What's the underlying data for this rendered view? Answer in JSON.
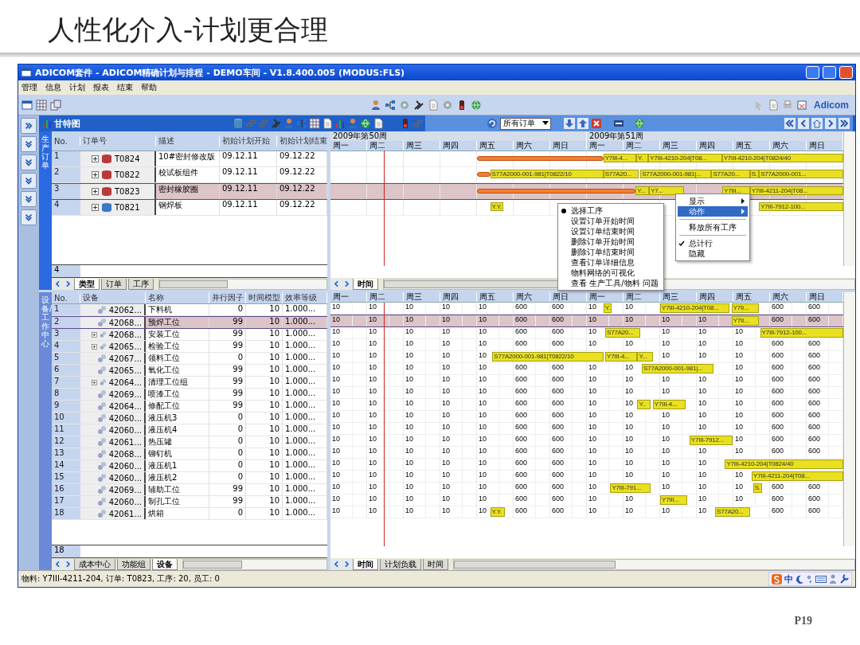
{
  "slide": {
    "title": "人性化介入-计划更合理",
    "page": "P19"
  },
  "window": {
    "title": "ADICOM套件 - ADICOM精确计划与排程 - DEMO车间 - V1.8.400.005 (MODUS:FLS)"
  },
  "menu": [
    "管理",
    "信息",
    "计划",
    "报表",
    "结束",
    "帮助"
  ],
  "toolbar": {
    "logo": "Adicom"
  },
  "gantt_header": {
    "title": "甘特图",
    "filter": "所有订单"
  },
  "orders": {
    "side_label": "生产订单",
    "columns": [
      "No.",
      "订单号",
      "描述",
      "初始计划开始",
      "初始计划结束"
    ],
    "weeks": [
      "2009年第50周",
      "2009年第51周"
    ],
    "days": [
      "周一",
      "周二",
      "周三",
      "周四",
      "周五",
      "周六",
      "周日",
      "周一",
      "周二",
      "周三",
      "周四",
      "周五",
      "周六",
      "周日"
    ],
    "rows": [
      {
        "no": "1",
        "order": "T0824",
        "desc": "10#密封修改版",
        "start": "09.12.11",
        "end": "09.12.22",
        "color": "#b83a3a",
        "has_children": true,
        "selected": false,
        "bars": [
          {
            "kind": "order"
          },
          {
            "kind": "task",
            "text": "Y7III-4..."
          },
          {
            "kind": "task",
            "text": "Y."
          },
          {
            "kind": "task",
            "text": "Y7III-4210-204|T08..."
          },
          {
            "kind": "task",
            "text": "Y7III-4210-204|T0824/40"
          }
        ]
      },
      {
        "no": "2",
        "order": "T0822",
        "desc": "校试板组件",
        "start": "09.12.11",
        "end": "09.12.22",
        "color": "#b83a3a",
        "has_children": true,
        "selected": false,
        "bars": [
          {
            "kind": "order"
          },
          {
            "kind": "task",
            "text": "S77A2000-001-981|T0822/10"
          },
          {
            "kind": "task",
            "text": "S77A20..."
          },
          {
            "kind": "task",
            "text": "S77A2000-001-981|..."
          },
          {
            "kind": "task",
            "text": "S77A20..."
          },
          {
            "kind": "task",
            "text": "S."
          },
          {
            "kind": "task",
            "text": "S77A2000-001..."
          }
        ]
      },
      {
        "no": "3",
        "order": "T0823",
        "desc": "密封橡胶圈",
        "start": "09.12.11",
        "end": "09.12.22",
        "color": "#b83a3a",
        "has_children": true,
        "selected": true,
        "bars": [
          {
            "kind": "order"
          },
          {
            "kind": "task",
            "text": "Y..."
          },
          {
            "kind": "task",
            "text": "Y7..."
          },
          {
            "kind": "task",
            "text": "Y7III..."
          },
          {
            "kind": "task",
            "text": "Y7III-4211-204|T08..."
          }
        ]
      },
      {
        "no": "4",
        "order": "T0821",
        "desc": "钢焊板",
        "start": "09.12.11",
        "end": "09.12.22",
        "color": "#3a78c8",
        "has_children": true,
        "selected": false,
        "bars": [
          {
            "kind": "task",
            "text": "Y.Y."
          },
          {
            "kind": "task",
            "text": "Y7III-7912-100..."
          }
        ]
      }
    ],
    "count": "4",
    "tabs": [
      {
        "label": "类型",
        "selected": true
      },
      {
        "label": "订单",
        "selected": false
      },
      {
        "label": "工序",
        "selected": false
      }
    ],
    "chart_tabs": [
      {
        "label": "时间",
        "selected": true
      }
    ]
  },
  "context_menu": {
    "items": [
      {
        "kind": "item",
        "label": "显示",
        "submenu": true,
        "selected": false
      },
      {
        "kind": "item",
        "label": "动作",
        "submenu": true,
        "selected": true
      },
      {
        "kind": "separator"
      },
      {
        "kind": "item",
        "label": "释放所有工序",
        "submenu": false,
        "selected": false
      },
      {
        "kind": "separator"
      },
      {
        "kind": "check",
        "label": "总计行",
        "checked": true
      },
      {
        "kind": "check",
        "label": "隐藏",
        "checked": false
      }
    ],
    "submenu": [
      {
        "label": "选择工序",
        "checked": true
      },
      {
        "label": "设置订单开始时间",
        "checked": false
      },
      {
        "label": "设置订单结束时间",
        "checked": false
      },
      {
        "label": "删除订单开始时间",
        "checked": false
      },
      {
        "label": "删除订单结束时间",
        "checked": false
      },
      {
        "label": "查看订单详细信息",
        "checked": false
      },
      {
        "label": "物料网络的可视化",
        "checked": false
      },
      {
        "label": "查看 生产工具/物料 问题",
        "checked": false
      }
    ]
  },
  "resources": {
    "side_label": "设备/工作中心",
    "columns": [
      "No.",
      "设备",
      "名称",
      "并行因子",
      "时间模型",
      "效率等级"
    ],
    "days": [
      "周一",
      "周二",
      "周三",
      "周四",
      "周五",
      "周六",
      "周日",
      "周一",
      "周二",
      "周三",
      "周四",
      "周五",
      "周六",
      "周日"
    ],
    "rows": [
      {
        "no": "1",
        "id": "42062...",
        "name": "下料机",
        "parallel": "0",
        "time_model": "10",
        "efficiency": "1.000...",
        "has_children": false,
        "selected": false,
        "cells": [
          "10",
          "10",
          "10",
          "10",
          "10",
          "600",
          "600",
          "10",
          "10",
          null,
          null,
          null,
          "600",
          "600"
        ],
        "bars": [
          {
            "text": "Y."
          },
          {
            "text": "Y7III-4210-204|T08..."
          },
          {
            "text": "Y7II..."
          }
        ]
      },
      {
        "no": "2",
        "id": "42068...",
        "name": "预焊工位",
        "parallel": "99",
        "time_model": "10",
        "efficiency": "1.000...",
        "has_children": false,
        "selected": true,
        "cells": [
          "10",
          "10",
          "10",
          "10",
          "10",
          "600",
          "600",
          "10",
          "10",
          "10",
          "10",
          null,
          "600",
          "600"
        ],
        "bars": [
          {
            "text": "Y7II..."
          }
        ]
      },
      {
        "no": "3",
        "id": "42068...",
        "name": "安装工位",
        "parallel": "99",
        "time_model": "10",
        "efficiency": "1.000...",
        "has_children": true,
        "selected": false,
        "cells": [
          "10",
          "10",
          "10",
          "10",
          "10",
          "600",
          "600",
          "10",
          null,
          "10",
          "10",
          "10",
          null,
          null
        ],
        "bars": [
          {
            "text": "S77A20..."
          },
          {
            "text": "Y7III-7912-100..."
          }
        ]
      },
      {
        "no": "4",
        "id": "42065...",
        "name": "检验工位",
        "parallel": "99",
        "time_model": "10",
        "efficiency": "1.000...",
        "has_children": true,
        "selected": false,
        "cells": [
          "10",
          "10",
          "10",
          "10",
          "10",
          "600",
          "600",
          "10",
          "10",
          "10",
          "10",
          "10",
          "600",
          "600"
        ],
        "bars": []
      },
      {
        "no": "5",
        "id": "42067...",
        "name": "领料工位",
        "parallel": "0",
        "time_model": "10",
        "efficiency": "1.000...",
        "has_children": false,
        "selected": false,
        "cells": [
          "10",
          "10",
          "10",
          "10",
          "10",
          null,
          null,
          null,
          null,
          "10",
          "10",
          "10",
          "600",
          "600"
        ],
        "bars": [
          {
            "text": "S77A2000-001-981|T0822/10"
          },
          {
            "text": "Y7III-4..."
          },
          {
            "text": "Y..."
          }
        ]
      },
      {
        "no": "6",
        "id": "42065...",
        "name": "氧化工位",
        "parallel": "99",
        "time_model": "10",
        "efficiency": "1.000...",
        "has_children": false,
        "selected": false,
        "cells": [
          "10",
          "10",
          "10",
          "10",
          "10",
          "600",
          "600",
          "10",
          "10",
          null,
          null,
          "10",
          "600",
          "600"
        ],
        "bars": [
          {
            "text": "S77A2000-001-981|..."
          }
        ]
      },
      {
        "no": "7",
        "id": "42064...",
        "name": "清理工位组",
        "parallel": "99",
        "time_model": "10",
        "efficiency": "1.000...",
        "has_children": true,
        "selected": false,
        "cells": [
          "10",
          "10",
          "10",
          "10",
          "10",
          "600",
          "600",
          "10",
          "10",
          "10",
          "10",
          "10",
          "600",
          "600"
        ],
        "bars": []
      },
      {
        "no": "8",
        "id": "42069...",
        "name": "喷漆工位",
        "parallel": "99",
        "time_model": "10",
        "efficiency": "1.000...",
        "has_children": false,
        "selected": false,
        "cells": [
          "10",
          "10",
          "10",
          "10",
          "10",
          "600",
          "600",
          "10",
          "10",
          "10",
          "10",
          "10",
          "600",
          "600"
        ],
        "bars": []
      },
      {
        "no": "9",
        "id": "42064...",
        "name": "修配工位",
        "parallel": "99",
        "time_model": "10",
        "efficiency": "1.000...",
        "has_children": false,
        "selected": false,
        "cells": [
          "10",
          "10",
          "10",
          "10",
          "10",
          "600",
          "600",
          "10",
          "10",
          null,
          "10",
          "10",
          "600",
          "600"
        ],
        "bars": [
          {
            "text": "Y.."
          },
          {
            "text": "Y7III-4..."
          }
        ]
      },
      {
        "no": "10",
        "id": "42060...",
        "name": "液压机3",
        "parallel": "0",
        "time_model": "10",
        "efficiency": "1.000...",
        "has_children": false,
        "selected": false,
        "cells": [
          "10",
          "10",
          "10",
          "10",
          "10",
          "600",
          "600",
          "10",
          "10",
          "10",
          "10",
          "10",
          "600",
          "600"
        ],
        "bars": []
      },
      {
        "no": "11",
        "id": "42060...",
        "name": "液压机4",
        "parallel": "0",
        "time_model": "10",
        "efficiency": "1.000...",
        "has_children": false,
        "selected": false,
        "cells": [
          "10",
          "10",
          "10",
          "10",
          "10",
          "600",
          "600",
          "10",
          "10",
          "10",
          "10",
          "10",
          "600",
          "600"
        ],
        "bars": []
      },
      {
        "no": "12",
        "id": "42061...",
        "name": "热压罐",
        "parallel": "0",
        "time_model": "10",
        "efficiency": "1.000...",
        "has_children": false,
        "selected": false,
        "cells": [
          "10",
          "10",
          "10",
          "10",
          "10",
          "600",
          "600",
          "10",
          "10",
          "10",
          null,
          "10",
          "600",
          "600"
        ],
        "bars": [
          {
            "text": "Y7III-7912..."
          }
        ]
      },
      {
        "no": "13",
        "id": "42068...",
        "name": "铆钉机",
        "parallel": "0",
        "time_model": "10",
        "efficiency": "1.000...",
        "has_children": false,
        "selected": false,
        "cells": [
          "10",
          "10",
          "10",
          "10",
          "10",
          "600",
          "600",
          "10",
          "10",
          "10",
          "10",
          "10",
          "600",
          "600"
        ],
        "bars": []
      },
      {
        "no": "14",
        "id": "42060...",
        "name": "液压机1",
        "parallel": "0",
        "time_model": "10",
        "efficiency": "1.000...",
        "has_children": false,
        "selected": false,
        "cells": [
          "10",
          "10",
          "10",
          "10",
          "10",
          "600",
          "600",
          "10",
          "10",
          "10",
          "10",
          null,
          null,
          null
        ],
        "bars": [
          {
            "text": "Y7III-4210-204|T0824/40"
          }
        ]
      },
      {
        "no": "15",
        "id": "42060...",
        "name": "液压机2",
        "parallel": "0",
        "time_model": "10",
        "efficiency": "1.000...",
        "has_children": false,
        "selected": false,
        "cells": [
          "10",
          "10",
          "10",
          "10",
          "10",
          "600",
          "600",
          "10",
          "10",
          "10",
          "10",
          "10",
          null,
          null
        ],
        "bars": [
          {
            "text": "Y7III-4211-204|T08..."
          }
        ]
      },
      {
        "no": "16",
        "id": "42069...",
        "name": "辅助工位",
        "parallel": "99",
        "time_model": "10",
        "efficiency": "1.000...",
        "has_children": false,
        "selected": false,
        "cells": [
          "10",
          "10",
          "10",
          "10",
          "10",
          "600",
          "600",
          "10",
          null,
          "10",
          "10",
          "10",
          "600",
          "600"
        ],
        "bars": [
          {
            "text": "Y7III-791..."
          },
          {
            "text": "S."
          }
        ]
      },
      {
        "no": "17",
        "id": "42060...",
        "name": "制孔工位",
        "parallel": "99",
        "time_model": "10",
        "efficiency": "1.000...",
        "has_children": false,
        "selected": false,
        "cells": [
          "10",
          "10",
          "10",
          "10",
          "10",
          "600",
          "600",
          "10",
          "10",
          null,
          "10",
          "10",
          "600",
          "600"
        ],
        "bars": [
          {
            "text": "Y7III..."
          }
        ]
      },
      {
        "no": "18",
        "id": "42061...",
        "name": "烘箱",
        "parallel": "0",
        "time_model": "10",
        "efficiency": "1.000...",
        "has_children": false,
        "selected": false,
        "cells": [
          "10",
          "10",
          "10",
          "10",
          "10",
          "600",
          "600",
          "10",
          "10",
          "10",
          "10",
          null,
          "600",
          "600"
        ],
        "bars": [
          {
            "text": "Y.Y."
          },
          {
            "text": "S77A20..."
          }
        ]
      }
    ],
    "count": "18",
    "tabs": [
      {
        "label": "成本中心",
        "selected": false
      },
      {
        "label": "功能组",
        "selected": false
      },
      {
        "label": "设备",
        "selected": true
      }
    ],
    "chart_tabs": [
      {
        "label": "时间",
        "selected": true
      },
      {
        "label": "计划负载",
        "selected": false
      },
      {
        "label": "时间",
        "selected": false
      }
    ]
  },
  "status_bar": {
    "text": "物料: Y7III-4211-204, 订单: T0823, 工序: 20, 员工: 0",
    "ime": "中"
  }
}
